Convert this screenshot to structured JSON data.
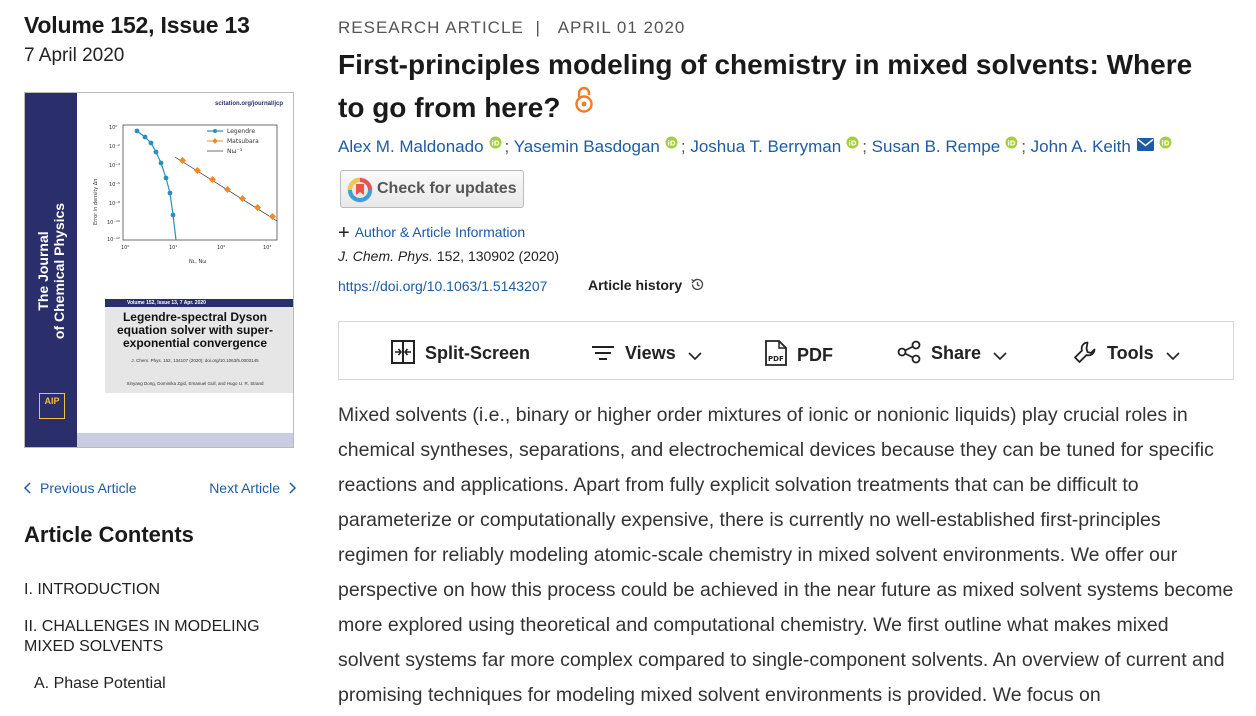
{
  "issue": {
    "volume_title": "Volume 152, Issue 13",
    "date": "7 April 2020"
  },
  "cover": {
    "url": "scitation.org/journal/jcp",
    "journal_name_line1": "The Journal",
    "journal_name_line2": "of Chemical Physics",
    "issue_band": "Volume 152, Issue 13, 7 Apr. 2020",
    "headline": "Legendre-spectral Dyson equation solver with super-exponential convergence",
    "citation": "J. Chem. Phys. 152, 134107 (2020); doi.org/10.1063/5.0003145",
    "authors": "Xinyang Dong, Dominika Zgid, Emanuel Gull, and Hugo U. R. Strand",
    "publisher": "AIP Publishing",
    "figure": {
      "ylabel": "Error in density Δn",
      "xlabel": "N_L, N_ω",
      "legend": [
        "Legendre",
        "Matsubara",
        "N_ω^-3"
      ],
      "y_ticks": [
        "10^0",
        "10^-2",
        "10^-4",
        "10^-6",
        "10^-8",
        "10^-10",
        "10^-12"
      ],
      "x_ticks": [
        "10^0",
        "10^1",
        "10^2",
        "10^3"
      ]
    }
  },
  "nav": {
    "prev": "Previous Article",
    "next": "Next Article"
  },
  "contents": {
    "title": "Article Contents",
    "items": [
      "I. INTRODUCTION",
      "II. CHALLENGES IN MODELING MIXED SOLVENTS",
      "A. Phase Potential"
    ]
  },
  "article": {
    "type": "RESEARCH ARTICLE",
    "separator": "|",
    "date": "APRIL 01 2020",
    "title": "First-principles modeling of chemistry in mixed solvents: Where to go from here?",
    "authors": [
      "Alex M. Maldonado",
      "Yasemin Basdogan",
      "Joshua T. Berryman",
      "Susan B. Rempe",
      "John A. Keith"
    ],
    "author_sep": ";",
    "check_updates": "Check for updates",
    "author_info": "Author & Article Information",
    "journal": "J. Chem. Phys.",
    "citation": "152, 130902 (2020)",
    "doi": "https://doi.org/10.1063/1.5143207",
    "history": "Article history"
  },
  "toolbar": {
    "split_screen": "Split-Screen",
    "views": "Views",
    "pdf": "PDF",
    "share": "Share",
    "tools": "Tools"
  },
  "abstract": "Mixed solvents (i.e., binary or higher order mixtures of ionic or nonionic liquids) play crucial roles in chemical syntheses, separations, and electrochemical devices because they can be tuned for specific reactions and applications. Apart from fully explicit solvation treatments that can be difficult to parameterize or computationally expensive, there is currently no well-established first-principles regimen for reliably modeling atomic-scale chemistry in mixed solvent environments. We offer our perspective on how this process could be achieved in the near future as mixed solvent systems become more explored using theoretical and computational chemistry. We first outline what makes mixed solvent systems far more complex compared to single-component solvents. An overview of current and promising techniques for modeling mixed solvent environments is provided. We focus on",
  "colors": {
    "link": "#1d5ba4",
    "open_access": "#f47c20",
    "orcid": "#a6ce39",
    "cover_navy": "#2a2f6b"
  }
}
